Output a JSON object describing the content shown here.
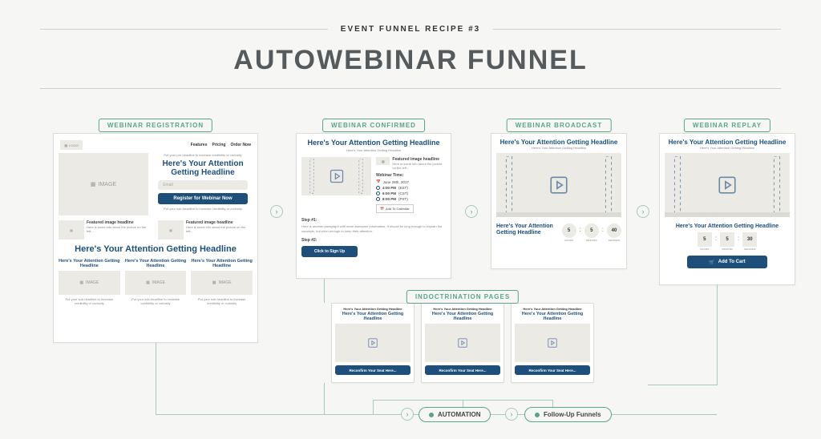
{
  "header": {
    "kicker": "EVENT FUNNEL RECIPE #3",
    "title": "AUTOWEBINAR FUNNEL"
  },
  "tags": {
    "registration": "WEBINAR REGISTRATION",
    "confirmed": "WEBINAR CONFIRMED",
    "broadcast": "WEBINAR BROADCAST",
    "replay": "WEBINAR REPLAY",
    "indoctrination": "INDOCTRINATION PAGES"
  },
  "common": {
    "logo": "LOGO",
    "image": "IMAGE",
    "video_icon": "play-icon",
    "attention_headline": "Here's Your Attention Getting Headline",
    "sub_headline": "Here's Your Attention Getting Headline",
    "featured_image_headline": "Featured image headline",
    "featured_desc": "Here is some info about the picture on the left...",
    "tiny_lead": "Put your pre-headline to increase credibility or curiosity",
    "tiny_sub": "Put your sub-headline to increase credibility or curiosity"
  },
  "registration": {
    "nav": {
      "features": "Features",
      "pricing": "Pricing",
      "order": "Order Now"
    },
    "email_placeholder": "Email",
    "register_btn": "Register for Webinar Now"
  },
  "confirmed": {
    "step1": "Step #1:",
    "step1_para": "Here is another paragraph with more awesome information.  It should be long enough to explain the concepts, but short enough to keep their attention.",
    "step2": "Step #2:",
    "signup_btn": "Click to Sign Up",
    "webinar_time_label": "Webinar Time:",
    "date": "June 28th, 2017",
    "times": [
      {
        "t": "4:00 PM",
        "tz": "(EST)"
      },
      {
        "t": "6:00 PM",
        "tz": "(CST)"
      },
      {
        "t": "8:00 PM",
        "tz": "(PST)"
      }
    ],
    "add_calendar": "Add To Calendar"
  },
  "timer": {
    "hours": "5",
    "hours_lbl": "HOURS",
    "minutes": "5",
    "minutes_lbl": "MINUTES",
    "seconds": "40",
    "seconds_lbl": "SECONDS",
    "seconds_replay": "30"
  },
  "replay": {
    "add_to_cart": "Add To Cart"
  },
  "indoc": {
    "small_headline": "Here's Your Attention Getting Headline",
    "reconfirm_btn": "Reconfirm Your Seat Here..."
  },
  "bottom": {
    "automation": "AUTOMATION",
    "followup": "Follow-Up Funnels"
  }
}
